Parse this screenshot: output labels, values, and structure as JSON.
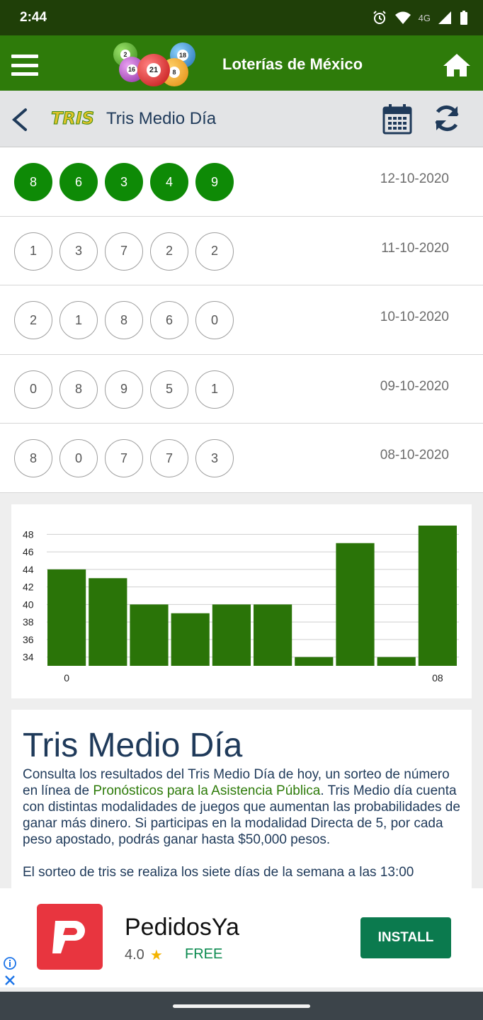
{
  "status_bar": {
    "time": "2:44",
    "network": "4G"
  },
  "app_bar": {
    "title": "Loterías de México",
    "logo_ball_numbers": [
      "2",
      "18",
      "16",
      "21",
      "8"
    ]
  },
  "sub_header": {
    "logo_text": "TRIS",
    "title": "Tris Medio Día"
  },
  "results": [
    {
      "numbers": [
        "8",
        "6",
        "3",
        "4",
        "9"
      ],
      "date": "12-10-2020",
      "latest": true
    },
    {
      "numbers": [
        "1",
        "3",
        "7",
        "2",
        "2"
      ],
      "date": "11-10-2020",
      "latest": false
    },
    {
      "numbers": [
        "2",
        "1",
        "8",
        "6",
        "0"
      ],
      "date": "10-10-2020",
      "latest": false
    },
    {
      "numbers": [
        "0",
        "8",
        "9",
        "5",
        "1"
      ],
      "date": "09-10-2020",
      "latest": false
    },
    {
      "numbers": [
        "8",
        "0",
        "7",
        "7",
        "3"
      ],
      "date": "08-10-2020",
      "latest": false
    }
  ],
  "chart_data": {
    "type": "bar",
    "title": "",
    "xlabel": "",
    "ylabel": "",
    "categories": [
      "0",
      "",
      "",
      "",
      "",
      "",
      "",
      "",
      "",
      "08"
    ],
    "values": [
      44,
      43,
      40,
      39,
      40,
      40,
      34,
      47,
      34,
      49
    ],
    "ylim": [
      33,
      49
    ],
    "yticks": [
      34,
      36,
      38,
      40,
      42,
      44,
      46,
      48
    ],
    "ytick_labels": [
      "34",
      "36",
      "38",
      "40",
      "42",
      "44",
      "46",
      "48"
    ],
    "grid": true,
    "bar_color": "#2a7408"
  },
  "article": {
    "title": "Tris Medio Día",
    "p1_before": "Consulta los resultados del Tris Medio Día de hoy, un sorteo de número en línea de ",
    "p1_link": "Pronósticos para la Asistencia Pública",
    "p1_after": ". Tris Medio día cuenta con distintas modalidades de juegos que aumentan las probabilidades de ganar más dinero. Si participas en la modalidad Directa de 5, por cada peso apostado, podrás ganar hasta $50,000 pesos.",
    "p2": "El sorteo de tris se realiza los siete días de la semana a las 13:00"
  },
  "ad": {
    "app_name": "PedidosYa",
    "rating": "4.0",
    "price": "FREE",
    "install_label": "INSTALL"
  },
  "colors": {
    "app_bar": "#2e7b0a",
    "status_bar": "#1f3f08",
    "ball_active": "#0e8a06",
    "link": "#2e7b0a",
    "title_text": "#1f3a5a",
    "install": "#0b7a4e",
    "ad_icon": "#e8353f"
  }
}
